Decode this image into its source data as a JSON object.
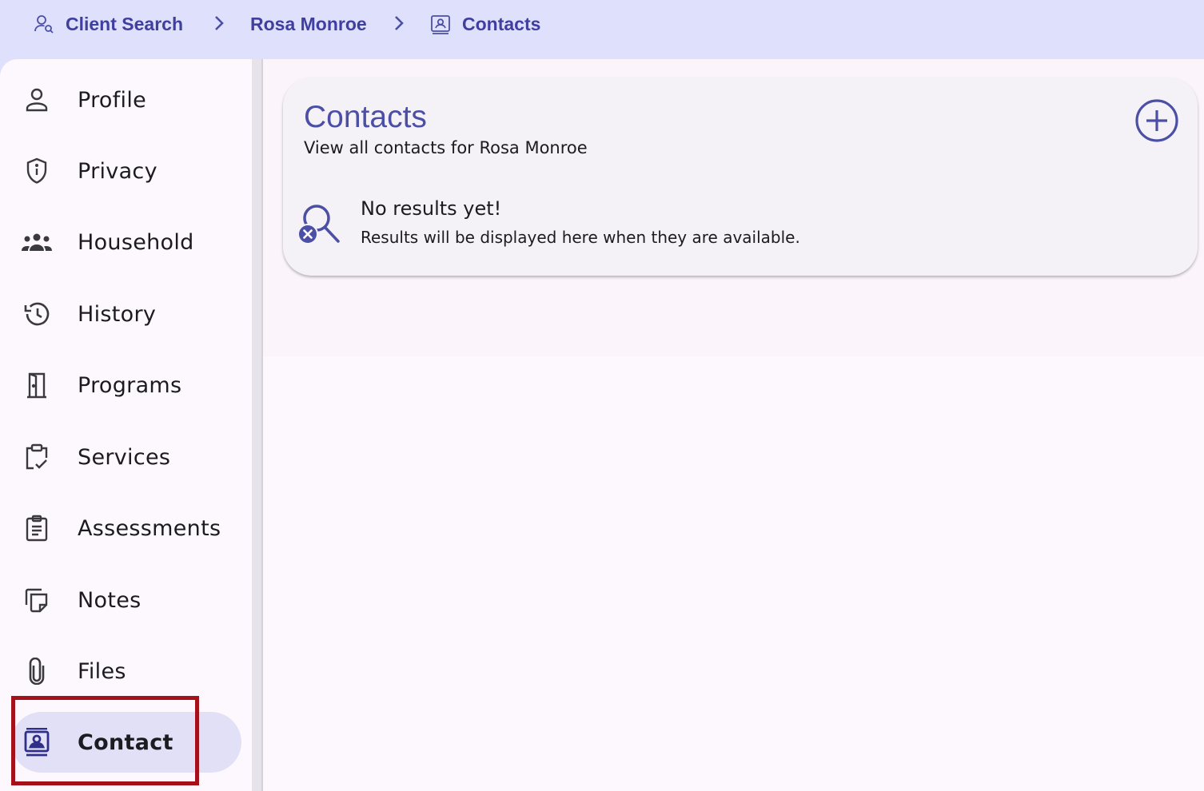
{
  "breadcrumb": {
    "items": [
      {
        "label": "Client Search",
        "icon": "person-search-icon"
      },
      {
        "label": "Rosa Monroe"
      },
      {
        "label": "Contacts",
        "icon": "contact-card-icon"
      }
    ]
  },
  "sidebar": {
    "items": [
      {
        "label": "Profile",
        "icon": "person-icon"
      },
      {
        "label": "Privacy",
        "icon": "shield-icon"
      },
      {
        "label": "Household",
        "icon": "group-icon"
      },
      {
        "label": "History",
        "icon": "history-icon"
      },
      {
        "label": "Programs",
        "icon": "door-icon"
      },
      {
        "label": "Services",
        "icon": "clipboard-check-icon"
      },
      {
        "label": "Assessments",
        "icon": "clipboard-list-icon"
      },
      {
        "label": "Notes",
        "icon": "notes-icon"
      },
      {
        "label": "Files",
        "icon": "paperclip-icon"
      },
      {
        "label": "Contact",
        "icon": "contact-card-icon",
        "active": true
      }
    ]
  },
  "card": {
    "title": "Contacts",
    "subtitle": "View all contacts for Rosa Monroe",
    "add_icon": "add-circle-icon",
    "empty": {
      "icon": "search-off-icon",
      "title": "No results yet!",
      "text": "Results will be displayed here when they are available."
    }
  },
  "colors": {
    "accent": "#4b4fa6",
    "topbar": "#dfe0fb",
    "highlight": "#a5111a"
  }
}
